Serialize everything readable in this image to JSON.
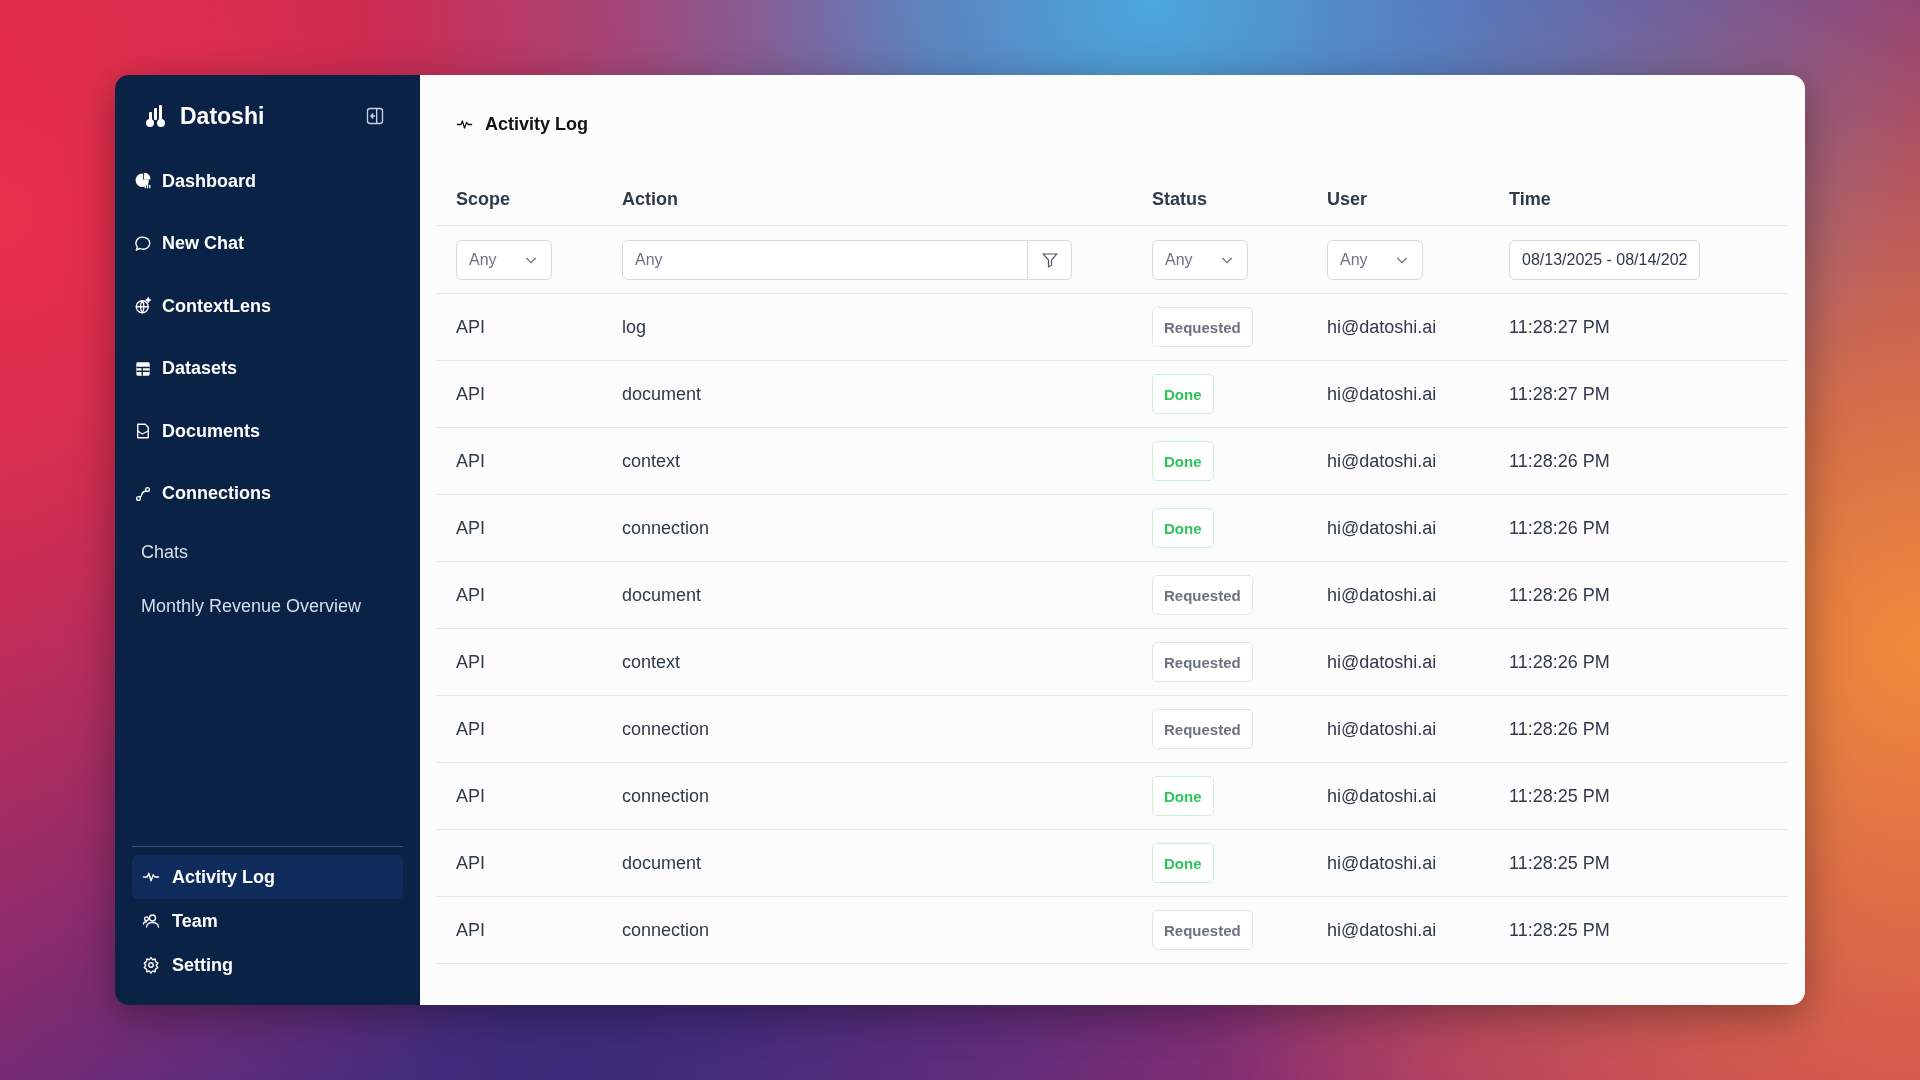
{
  "app": {
    "name": "Datoshi"
  },
  "nav": [
    {
      "label": "Dashboard",
      "selected": false
    },
    {
      "label": "New Chat",
      "selected": false
    },
    {
      "label": "ContextLens",
      "selected": false
    },
    {
      "label": "Datasets",
      "selected": false
    },
    {
      "label": "Documents",
      "selected": false
    },
    {
      "label": "Connections",
      "selected": false
    }
  ],
  "chats": {
    "heading": "Chats",
    "items": [
      "Monthly Revenue Overview"
    ]
  },
  "bottom_nav": [
    {
      "label": "Activity Log",
      "selected": true
    },
    {
      "label": "Team",
      "selected": false
    },
    {
      "label": "Setting",
      "selected": false
    }
  ],
  "page": {
    "title": "Activity Log"
  },
  "table": {
    "columns": [
      "Scope",
      "Action",
      "Status",
      "User",
      "Time"
    ],
    "filters": {
      "scope": "Any",
      "action_placeholder": "Any",
      "status": "Any",
      "user": "Any",
      "time": "08/13/2025 - 08/14/202"
    },
    "rows": [
      {
        "scope": "API",
        "action": "log",
        "status": {
          "label": "Requested",
          "kind": "requested"
        },
        "user": "hi@datoshi.ai",
        "time": "11:28:27 PM"
      },
      {
        "scope": "API",
        "action": "document",
        "status": {
          "label": "Done",
          "kind": "done"
        },
        "user": "hi@datoshi.ai",
        "time": "11:28:27 PM"
      },
      {
        "scope": "API",
        "action": "context",
        "status": {
          "label": "Done",
          "kind": "done"
        },
        "user": "hi@datoshi.ai",
        "time": "11:28:26 PM"
      },
      {
        "scope": "API",
        "action": "connection",
        "status": {
          "label": "Done",
          "kind": "done"
        },
        "user": "hi@datoshi.ai",
        "time": "11:28:26 PM"
      },
      {
        "scope": "API",
        "action": "document",
        "status": {
          "label": "Requested",
          "kind": "requested"
        },
        "user": "hi@datoshi.ai",
        "time": "11:28:26 PM"
      },
      {
        "scope": "API",
        "action": "context",
        "status": {
          "label": "Requested",
          "kind": "requested"
        },
        "user": "hi@datoshi.ai",
        "time": "11:28:26 PM"
      },
      {
        "scope": "API",
        "action": "connection",
        "status": {
          "label": "Requested",
          "kind": "requested"
        },
        "user": "hi@datoshi.ai",
        "time": "11:28:26 PM"
      },
      {
        "scope": "API",
        "action": "connection",
        "status": {
          "label": "Done",
          "kind": "done"
        },
        "user": "hi@datoshi.ai",
        "time": "11:28:25 PM"
      },
      {
        "scope": "API",
        "action": "document",
        "status": {
          "label": "Done",
          "kind": "done"
        },
        "user": "hi@datoshi.ai",
        "time": "11:28:25 PM"
      },
      {
        "scope": "API",
        "action": "connection",
        "status": {
          "label": "Requested",
          "kind": "requested"
        },
        "user": "hi@datoshi.ai",
        "time": "11:28:25 PM"
      }
    ]
  }
}
